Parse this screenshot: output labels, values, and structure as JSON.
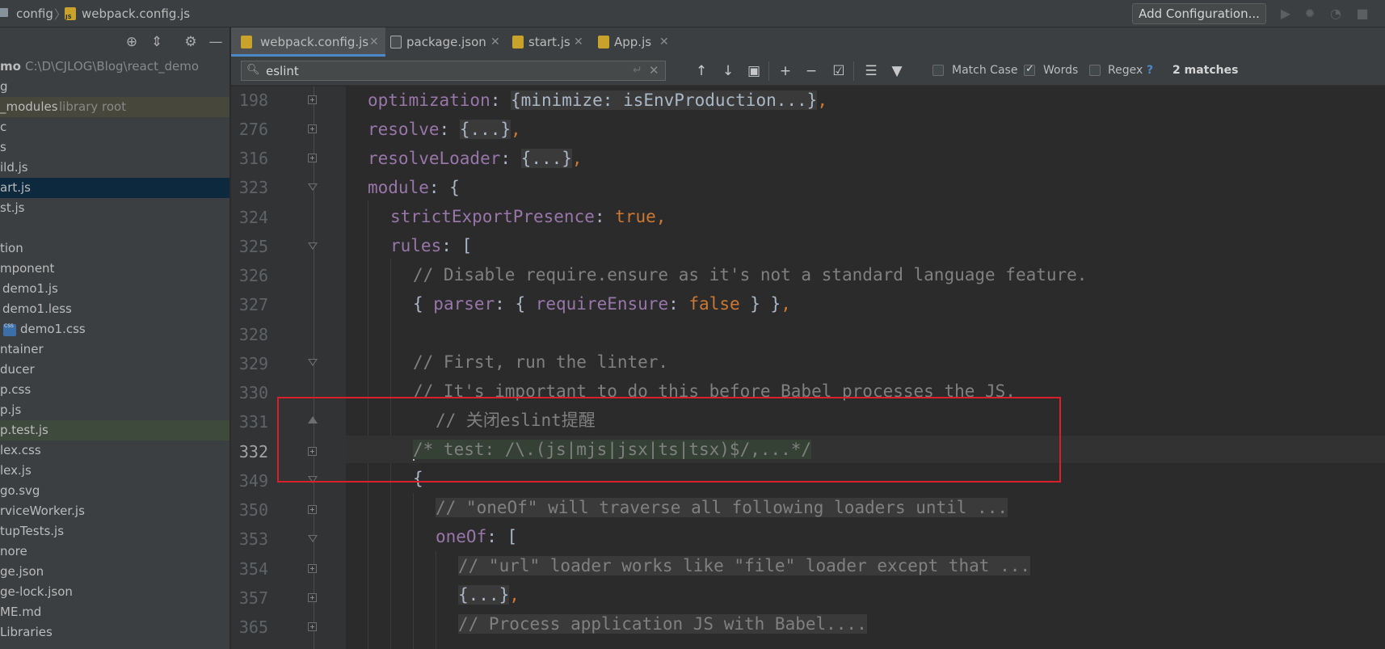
{
  "breadcrumb": {
    "folder": "config",
    "file": "webpack.config.js"
  },
  "toolbar": {
    "add_configuration": "Add Configuration..."
  },
  "sidebar": {
    "rows": [
      {
        "label": "mo",
        "extra": "C:\\D\\CJLOG\\Blog\\react_demo"
      },
      {
        "label": "g"
      },
      {
        "label": "_modules",
        "extra": "library root"
      },
      {
        "label": "c"
      },
      {
        "label": "s"
      },
      {
        "label": "ild.js"
      },
      {
        "label": "art.js"
      },
      {
        "label": "st.js"
      },
      {
        "label": ""
      },
      {
        "label": "tion"
      },
      {
        "label": "mponent"
      },
      {
        "label": "demo1.js"
      },
      {
        "label": "demo1.less"
      },
      {
        "label": "demo1.css"
      },
      {
        "label": "ntainer"
      },
      {
        "label": "ducer"
      },
      {
        "label": "p.css"
      },
      {
        "label": "p.js"
      },
      {
        "label": "p.test.js"
      },
      {
        "label": "lex.css"
      },
      {
        "label": "lex.js"
      },
      {
        "label": "go.svg"
      },
      {
        "label": "rviceWorker.js"
      },
      {
        "label": "tupTests.js"
      },
      {
        "label": "nore"
      },
      {
        "label": "ge.json"
      },
      {
        "label": "ge-lock.json"
      },
      {
        "label": "ME.md"
      },
      {
        "label": "Libraries"
      }
    ]
  },
  "tabs": [
    {
      "label": "webpack.config.js"
    },
    {
      "label": "package.json"
    },
    {
      "label": "start.js"
    },
    {
      "label": "App.js"
    }
  ],
  "search": {
    "query": "eslint",
    "match_case_label": "Match Case",
    "words_label": "Words",
    "regex_label": "Regex",
    "help": "?",
    "matches": "2 matches"
  },
  "editor": {
    "lines": [
      {
        "num": "198",
        "p1": "optimization",
        "p2": ": ",
        "p3": "{minimize: isEnvProduction...}",
        "p4": ","
      },
      {
        "num": "276",
        "p1": "resolve",
        "p2": ": ",
        "p3": "{...}",
        "p4": ","
      },
      {
        "num": "316",
        "p1": "resolveLoader",
        "p2": ": ",
        "p3": "{...}",
        "p4": ","
      },
      {
        "num": "323",
        "p1": "module",
        "p2": ": {"
      },
      {
        "num": "324",
        "p1": "strictExportPresence",
        "p2": ": ",
        "p3": "true",
        "p4": ","
      },
      {
        "num": "325",
        "p1": "rules",
        "p2": ": ["
      },
      {
        "num": "326",
        "text": "// Disable require.ensure as it's not a standard language feature."
      },
      {
        "num": "327",
        "p1": "{ ",
        "p2": "parser",
        "p3": ": { ",
        "p4": "requireEnsure",
        "p5": ": ",
        "p6": "false",
        "p7": " } }",
        "p8": ","
      },
      {
        "num": "328",
        "text": ""
      },
      {
        "num": "329",
        "text": "// First, run the linter."
      },
      {
        "num": "330",
        "text": "// It's important to do this before Babel processes the JS."
      },
      {
        "num": "331",
        "text": "// 关闭eslint提醒"
      },
      {
        "num": "332",
        "text": "/* test: /\\.(js|mjs|jsx|ts|tsx)$/,...*/"
      },
      {
        "num": "349",
        "text": "{"
      },
      {
        "num": "350",
        "text": "// \"oneOf\" will traverse all following loaders until ..."
      },
      {
        "num": "353",
        "p1": "oneOf",
        "p2": ": ["
      },
      {
        "num": "354",
        "text": "// \"url\" loader works like \"file\" loader except that ..."
      },
      {
        "num": "357",
        "p1": "{...}",
        "p2": ","
      },
      {
        "num": "365",
        "text": "// Process application JS with Babel...."
      }
    ]
  }
}
